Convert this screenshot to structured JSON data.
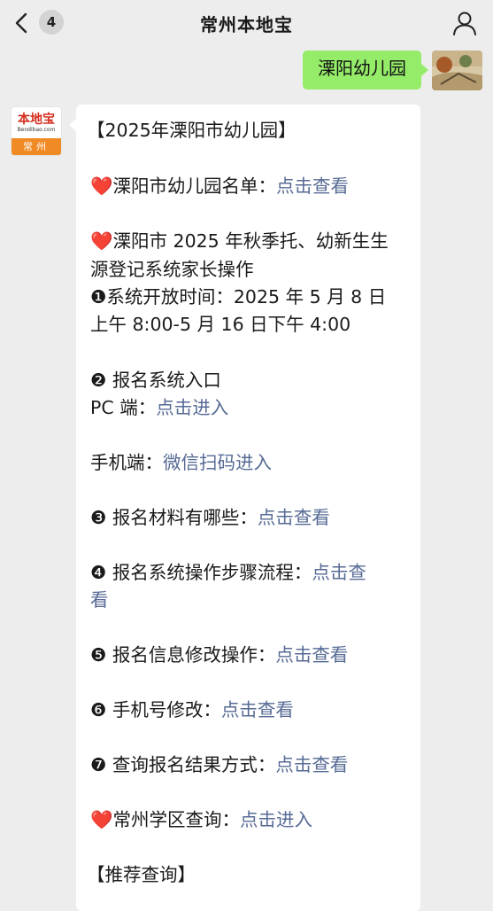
{
  "header": {
    "back_count": "4",
    "title": "常州本地宝"
  },
  "user_message": {
    "text": "溧阳幼儿园"
  },
  "bot_avatar": {
    "brand": "本地宝",
    "url": "Bendibao.com",
    "city": "常州"
  },
  "message": {
    "title": "【2025年溧阳市幼儿园】",
    "list_text": "溧阳市幼儿园名单：",
    "list_link": "点击查看",
    "reg_line1": "溧阳市 2025 年秋季托、幼新生生",
    "reg_line2": "源登记系统家长操作",
    "open_time_line1": "❶系统开放时间：2025 年 5 月 8 日",
    "open_time_line2": "上午 8:00-5 月 16 日下午 4:00",
    "entry_title": "❷ 报名系统入口",
    "pc_text": "PC 端：",
    "pc_link": "点击进入",
    "mobile_text": "手机端：",
    "mobile_link": "微信扫码进入",
    "materials_text": "❸ 报名材料有哪些：",
    "materials_link": "点击查看",
    "steps_text": "❹ 报名系统操作步骤流程：",
    "steps_link_part1": "点击查",
    "steps_link_part2": "看",
    "modify_text": "❺ 报名信息修改操作：",
    "modify_link": "点击查看",
    "phone_text": "❻ 手机号修改：",
    "phone_link": "点击查看",
    "result_text": "❼ 查询报名结果方式：",
    "result_link": "点击查看",
    "district_text": "常州学区查询：",
    "district_link": "点击进入",
    "recommend": "【推荐查询】"
  },
  "icons": {
    "back": "chevron-left-icon",
    "profile": "person-icon",
    "heart": "heart-icon"
  },
  "colors": {
    "bubble_green": "#95ec69",
    "link": "#576b95",
    "heart": "#e0242a",
    "background": "#ededed"
  }
}
